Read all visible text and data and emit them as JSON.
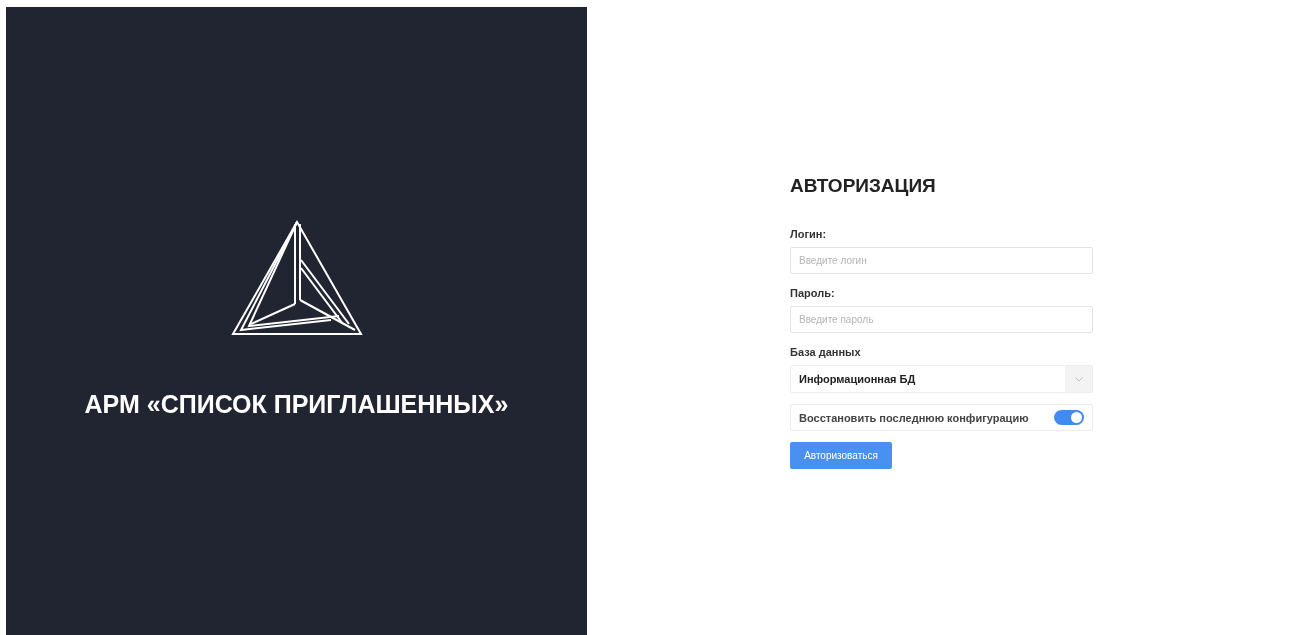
{
  "brand": {
    "title": "АРМ «СПИСОК ПРИГЛАШЕННЫХ»"
  },
  "form": {
    "heading": "АВТОРИЗАЦИЯ",
    "fields": [
      {
        "kind": "input",
        "label": "Логин:",
        "placeholder": "Введите логин"
      },
      {
        "kind": "input",
        "label": "Пароль:",
        "placeholder": "Введите пароль"
      },
      {
        "kind": "select",
        "label": "База данных",
        "value": "Информационная БД"
      }
    ],
    "toggle": {
      "label": "Восстановить последнюю конфигурацию",
      "on": true
    },
    "submit": "Авторизоваться"
  }
}
